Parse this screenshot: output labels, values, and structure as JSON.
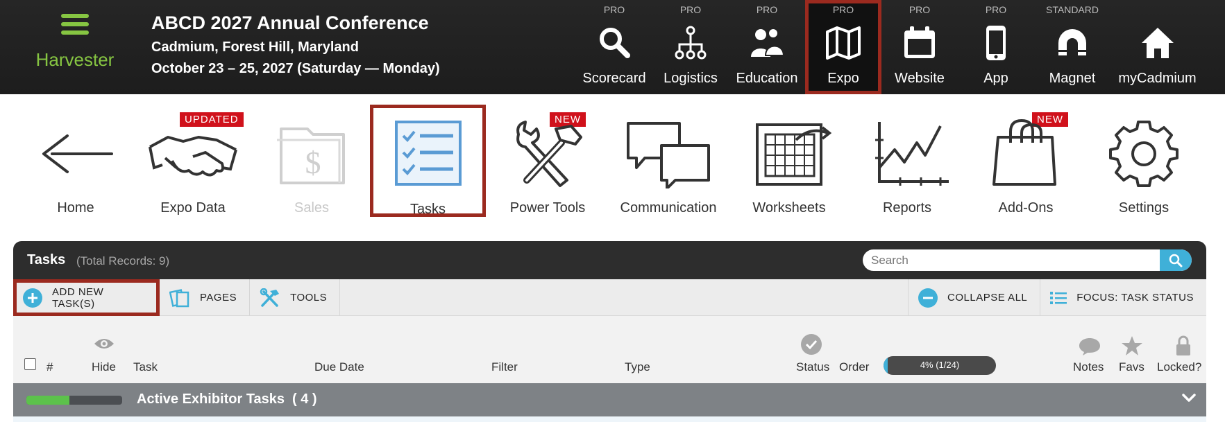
{
  "brand": {
    "name": "Harvester",
    "menu_icon": "hamburger-menu-icon",
    "color": "#86c542"
  },
  "conference": {
    "title": "ABCD 2027 Annual Conference",
    "location": "Cadmium, Forest Hill, Maryland",
    "dates": "October 23 – 25, 2027 (Saturday — Monday)"
  },
  "topnav": [
    {
      "tier": "PRO",
      "label": "Scorecard",
      "icon": "search-icon"
    },
    {
      "tier": "PRO",
      "label": "Logistics",
      "icon": "org-chart-icon"
    },
    {
      "tier": "PRO",
      "label": "Education",
      "icon": "people-icon"
    },
    {
      "tier": "PRO",
      "label": "Expo",
      "icon": "map-icon",
      "active": true
    },
    {
      "tier": "PRO",
      "label": "Website",
      "icon": "calendar-icon"
    },
    {
      "tier": "PRO",
      "label": "App",
      "icon": "phone-icon"
    },
    {
      "tier": "STANDARD",
      "label": "Magnet",
      "icon": "magnet-icon"
    },
    {
      "tier": "",
      "label": "myCadmium",
      "icon": "home-icon"
    }
  ],
  "tools": [
    {
      "label": "Home",
      "icon": "arrow-left-icon"
    },
    {
      "label": "Expo Data",
      "icon": "handshake-icon",
      "badge": "UPDATED"
    },
    {
      "label": "Sales",
      "icon": "dollar-folder-icon",
      "disabled": true
    },
    {
      "label": "Tasks",
      "icon": "task-list-icon",
      "selected": true
    },
    {
      "label": "Power Tools",
      "icon": "wrench-hammer-icon",
      "badge": "NEW"
    },
    {
      "label": "Communication",
      "icon": "speech-bubbles-icon"
    },
    {
      "label": "Worksheets",
      "icon": "spreadsheet-icon"
    },
    {
      "label": "Reports",
      "icon": "line-graph-icon"
    },
    {
      "label": "Add-Ons",
      "icon": "shopping-bag-icon",
      "badge": "NEW"
    },
    {
      "label": "Settings",
      "icon": "gear-icon"
    }
  ],
  "panel": {
    "title": "Tasks",
    "record_count": "(Total Records: 9)",
    "search_placeholder": "Search"
  },
  "actions": {
    "add_new": "ADD NEW TASK(S)",
    "pages": "PAGES",
    "tools": "TOOLS",
    "collapse_all": "COLLAPSE ALL",
    "focus": "FOCUS: TASK STATUS"
  },
  "columns": {
    "number": "#",
    "hide": "Hide",
    "task": "Task",
    "due_date": "Due Date",
    "filter": "Filter",
    "type": "Type",
    "status": "Status",
    "order": "Order",
    "progress_text": "4% (1/24)",
    "progress_fraction": 0.04,
    "notes": "Notes",
    "favs": "Favs",
    "locked": "Locked?"
  },
  "group": {
    "title": "Active Exhibitor Tasks",
    "count": "( 4 )",
    "progress_fraction": 0.45
  },
  "colors": {
    "accent": "#3fb0d8",
    "highlight_border": "#9b2a1f",
    "badge_red": "#d0111b",
    "header_bg": "#222222"
  }
}
